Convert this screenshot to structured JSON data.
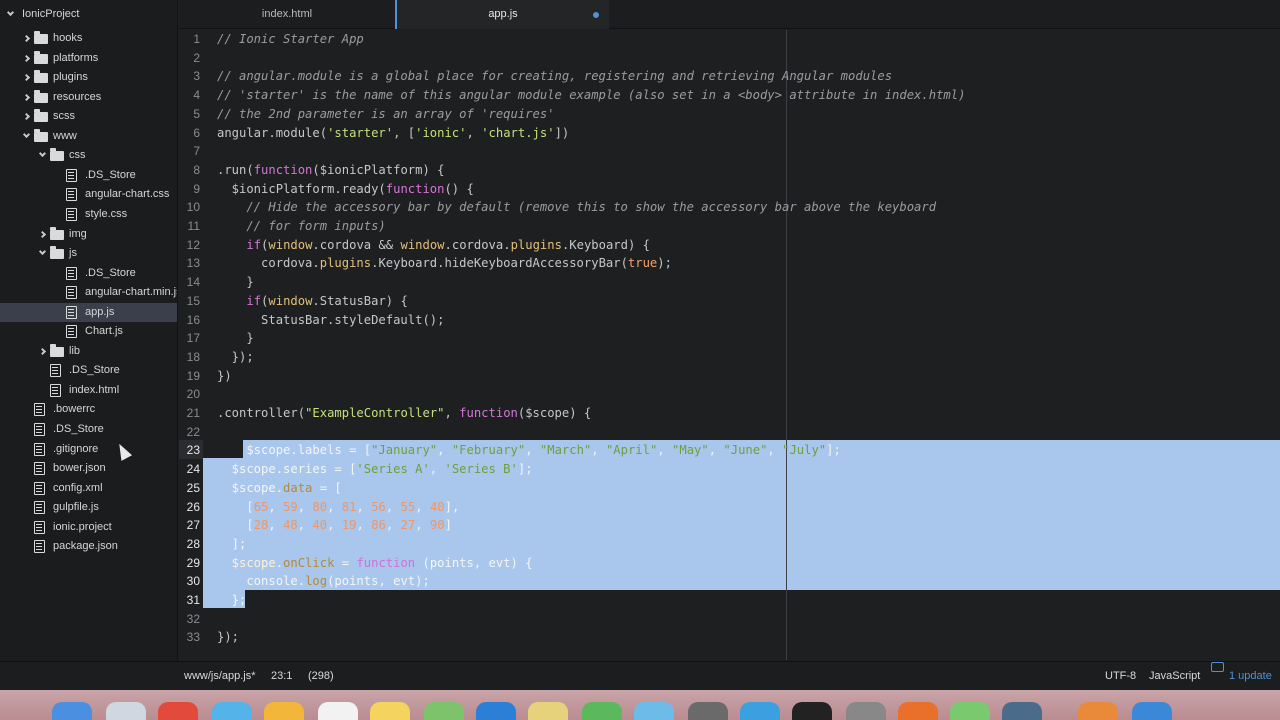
{
  "tree": {
    "project": "IonicProject",
    "items": [
      {
        "label": "hooks",
        "kind": "folder",
        "state": "closed"
      },
      {
        "label": "platforms",
        "kind": "folder",
        "state": "closed"
      },
      {
        "label": "plugins",
        "kind": "folder",
        "state": "closed"
      },
      {
        "label": "resources",
        "kind": "folder",
        "state": "closed"
      },
      {
        "label": "scss",
        "kind": "folder",
        "state": "closed"
      },
      {
        "label": "www",
        "kind": "folder",
        "state": "open"
      },
      {
        "label": "css",
        "kind": "folder",
        "state": "open"
      },
      {
        "label": ".DS_Store",
        "kind": "file"
      },
      {
        "label": "angular-chart.css",
        "kind": "file"
      },
      {
        "label": "style.css",
        "kind": "file"
      },
      {
        "label": "img",
        "kind": "folder",
        "state": "closed"
      },
      {
        "label": "js",
        "kind": "folder",
        "state": "open"
      },
      {
        "label": ".DS_Store",
        "kind": "file"
      },
      {
        "label": "angular-chart.min.js",
        "kind": "file"
      },
      {
        "label": "app.js",
        "kind": "file",
        "selected": true
      },
      {
        "label": "Chart.js",
        "kind": "file"
      },
      {
        "label": "lib",
        "kind": "folder",
        "state": "closed"
      },
      {
        "label": ".DS_Store",
        "kind": "file"
      },
      {
        "label": "index.html",
        "kind": "file"
      },
      {
        "label": ".bowerrc",
        "kind": "file"
      },
      {
        "label": ".DS_Store",
        "kind": "file"
      },
      {
        "label": ".gitignore",
        "kind": "file"
      },
      {
        "label": "bower.json",
        "kind": "file"
      },
      {
        "label": "config.xml",
        "kind": "file"
      },
      {
        "label": "gulpfile.js",
        "kind": "file"
      },
      {
        "label": "ionic.project",
        "kind": "file"
      },
      {
        "label": "package.json",
        "kind": "file"
      }
    ]
  },
  "tabs": [
    {
      "label": "index.html",
      "active": false
    },
    {
      "label": "app.js",
      "active": true,
      "modified": true
    }
  ],
  "editor": {
    "selection_lines": [
      23,
      31
    ],
    "lines": [
      {
        "n": "1",
        "tokens": [
          [
            "c-comment",
            "// Ionic Starter App"
          ]
        ]
      },
      {
        "n": "2",
        "tokens": []
      },
      {
        "n": "3",
        "tokens": [
          [
            "c-comment",
            "// angular.module is a global place for creating, registering and retrieving Angular modules"
          ]
        ]
      },
      {
        "n": "4",
        "tokens": [
          [
            "c-comment",
            "// 'starter' is the name of this angular module example (also set in a <body> attribute in index.html)"
          ]
        ]
      },
      {
        "n": "5",
        "tokens": [
          [
            "c-comment",
            "// the 2nd parameter is an array of 'requires'"
          ]
        ]
      },
      {
        "n": "6",
        "tokens": [
          [
            "",
            "angular.module("
          ],
          [
            "c-string",
            "'starter'"
          ],
          [
            "",
            ", ["
          ],
          [
            "c-string",
            "'ionic'"
          ],
          [
            "",
            ", "
          ],
          [
            "c-string",
            "'chart.js'"
          ],
          [
            "",
            "])"
          ]
        ]
      },
      {
        "n": "7",
        "tokens": []
      },
      {
        "n": "8",
        "tokens": [
          [
            "",
            ".run("
          ],
          [
            "c-keyword",
            "function"
          ],
          [
            "",
            "($ionicPlatform) {"
          ]
        ]
      },
      {
        "n": "9",
        "tokens": [
          [
            "",
            "  $ionicPlatform.ready("
          ],
          [
            "c-keyword",
            "function"
          ],
          [
            "",
            "() {"
          ]
        ]
      },
      {
        "n": "10",
        "tokens": [
          [
            "c-comment",
            "    // Hide the accessory bar by default (remove this to show the accessory bar above the keyboard"
          ]
        ]
      },
      {
        "n": "11",
        "tokens": [
          [
            "c-comment",
            "    // for form inputs)"
          ]
        ]
      },
      {
        "n": "12",
        "tokens": [
          [
            "",
            "    "
          ],
          [
            "c-keyword",
            "if"
          ],
          [
            "",
            "("
          ],
          [
            "c-builtin",
            "window"
          ],
          [
            "",
            ".cordova && "
          ],
          [
            "c-builtin",
            "window"
          ],
          [
            "",
            ".cordova."
          ],
          [
            "c-prop",
            "plugins"
          ],
          [
            "",
            ".Keyboard) {"
          ]
        ]
      },
      {
        "n": "13",
        "tokens": [
          [
            "",
            "      cordova."
          ],
          [
            "c-prop",
            "plugins"
          ],
          [
            "",
            ".Keyboard.hideKeyboardAccessoryBar("
          ],
          [
            "c-num",
            "true"
          ],
          [
            "",
            ");"
          ]
        ]
      },
      {
        "n": "14",
        "tokens": [
          [
            "",
            "    }"
          ]
        ]
      },
      {
        "n": "15",
        "tokens": [
          [
            "",
            "    "
          ],
          [
            "c-keyword",
            "if"
          ],
          [
            "",
            "("
          ],
          [
            "c-builtin",
            "window"
          ],
          [
            "",
            ".StatusBar) {"
          ]
        ]
      },
      {
        "n": "16",
        "tokens": [
          [
            "",
            "      StatusBar.styleDefault();"
          ]
        ]
      },
      {
        "n": "17",
        "tokens": [
          [
            "",
            "    }"
          ]
        ]
      },
      {
        "n": "18",
        "tokens": [
          [
            "",
            "  });"
          ]
        ]
      },
      {
        "n": "19",
        "tokens": [
          [
            "",
            "})"
          ]
        ]
      },
      {
        "n": "20",
        "tokens": []
      },
      {
        "n": "21",
        "tokens": [
          [
            "",
            ".controller("
          ],
          [
            "c-string",
            "\"ExampleController\""
          ],
          [
            "",
            ", "
          ],
          [
            "c-keyword",
            "function"
          ],
          [
            "",
            "($scope) {"
          ]
        ]
      },
      {
        "n": "22",
        "tokens": []
      },
      {
        "n": "23",
        "tokens": [
          [
            "",
            "    $scope.labels = ["
          ],
          [
            "c-string",
            "\"January\""
          ],
          [
            "",
            ", "
          ],
          [
            "c-string",
            "\"February\""
          ],
          [
            "",
            ", "
          ],
          [
            "c-string",
            "\"March\""
          ],
          [
            "",
            ", "
          ],
          [
            "c-string",
            "\"April\""
          ],
          [
            "",
            ", "
          ],
          [
            "c-string",
            "\"May\""
          ],
          [
            "",
            ", "
          ],
          [
            "c-string",
            "\"June\""
          ],
          [
            "",
            ", "
          ],
          [
            "c-string",
            "\"July\""
          ],
          [
            "",
            "];"
          ]
        ]
      },
      {
        "n": "24",
        "tokens": [
          [
            "",
            "  $scope.series = ["
          ],
          [
            "c-string",
            "'Series A'"
          ],
          [
            "",
            ", "
          ],
          [
            "c-string",
            "'Series B'"
          ],
          [
            "",
            "];"
          ]
        ]
      },
      {
        "n": "25",
        "tokens": [
          [
            "",
            "  $scope."
          ],
          [
            "c-prop",
            "data"
          ],
          [
            "",
            " = ["
          ]
        ]
      },
      {
        "n": "26",
        "tokens": [
          [
            "",
            "    ["
          ],
          [
            "c-num",
            "65"
          ],
          [
            "",
            ", "
          ],
          [
            "c-num",
            "59"
          ],
          [
            "",
            ", "
          ],
          [
            "c-num",
            "80"
          ],
          [
            "",
            ", "
          ],
          [
            "c-num",
            "81"
          ],
          [
            "",
            ", "
          ],
          [
            "c-num",
            "56"
          ],
          [
            "",
            ", "
          ],
          [
            "c-num",
            "55"
          ],
          [
            "",
            ", "
          ],
          [
            "c-num",
            "40"
          ],
          [
            "",
            "],"
          ]
        ]
      },
      {
        "n": "27",
        "tokens": [
          [
            "",
            "    ["
          ],
          [
            "c-num",
            "28"
          ],
          [
            "",
            ", "
          ],
          [
            "c-num",
            "48"
          ],
          [
            "",
            ", "
          ],
          [
            "c-num",
            "40"
          ],
          [
            "",
            ", "
          ],
          [
            "c-num",
            "19"
          ],
          [
            "",
            ", "
          ],
          [
            "c-num",
            "86"
          ],
          [
            "",
            ", "
          ],
          [
            "c-num",
            "27"
          ],
          [
            "",
            ", "
          ],
          [
            "c-num",
            "90"
          ],
          [
            "",
            "]"
          ]
        ]
      },
      {
        "n": "28",
        "tokens": [
          [
            "",
            "  ];"
          ]
        ]
      },
      {
        "n": "29",
        "tokens": [
          [
            "c-var",
            "  $scope"
          ],
          [
            "",
            "."
          ],
          [
            "c-prop",
            "onClick"
          ],
          [
            "",
            " = "
          ],
          [
            "c-keyword",
            "function"
          ],
          [
            "",
            " (points, evt) {"
          ]
        ]
      },
      {
        "n": "30",
        "tokens": [
          [
            "",
            "    console."
          ],
          [
            "c-prop",
            "log"
          ],
          [
            "",
            "(points, evt);"
          ]
        ]
      },
      {
        "n": "31",
        "tokens": [
          [
            "",
            "  };"
          ]
        ]
      },
      {
        "n": "32",
        "tokens": []
      },
      {
        "n": "33",
        "tokens": [
          [
            "",
            "});"
          ]
        ]
      }
    ]
  },
  "status": {
    "path": "www/js/app.js*",
    "cursor": "23:1",
    "selection_count": "(298)",
    "encoding": "UTF-8",
    "grammar": "JavaScript",
    "updates": "1 update"
  },
  "colors": {
    "accent": "#5390d6",
    "selection": "#a9c6ec",
    "editor_bg": "#1d1f21"
  }
}
